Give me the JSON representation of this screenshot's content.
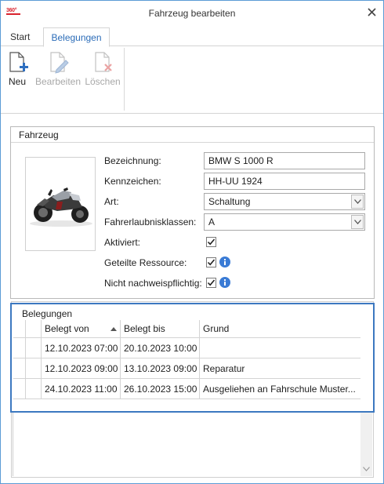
{
  "app": {
    "logo_text": "360°",
    "window_title": "Fahrzeug bearbeiten"
  },
  "tabs": [
    {
      "label": "Start",
      "active": false
    },
    {
      "label": "Belegungen",
      "active": true
    }
  ],
  "ribbon": {
    "new_label": "Neu",
    "edit_label": "Bearbeiten",
    "delete_label": "Löschen"
  },
  "vehicle": {
    "group_title": "Fahrzeug",
    "fields": {
      "bezeichnung": {
        "label": "Bezeichnung:",
        "value": "BMW S 1000 R"
      },
      "kennzeichen": {
        "label": "Kennzeichen:",
        "value": "HH-UU 1924"
      },
      "art": {
        "label": "Art:",
        "value": "Schaltung"
      },
      "fahrerlaubnisklassen": {
        "label": "Fahrerlaubnisklassen:",
        "value": "A"
      },
      "aktiviert": {
        "label": "Aktiviert:",
        "checked": true
      },
      "geteilte_ressource": {
        "label": "Geteilte Ressource:",
        "checked": true
      },
      "nicht_nachweispflichtig": {
        "label": "Nicht nachweispflichtig:",
        "checked": true
      }
    }
  },
  "bookings": {
    "group_title": "Belegungen",
    "columns": [
      "Belegt von",
      "Belegt bis",
      "Grund"
    ],
    "sort_column": "Belegt von",
    "sort_direction": "ascending",
    "rows": [
      {
        "von": "12.10.2023 07:00",
        "bis": "20.10.2023 10:00",
        "grund": ""
      },
      {
        "von": "12.10.2023 09:00",
        "bis": "13.10.2023 09:00",
        "grund": "Reparatur"
      },
      {
        "von": "24.10.2023 11:00",
        "bis": "26.10.2023 15:00",
        "grund": "Ausgeliehen an Fahrschule Muster..."
      }
    ]
  },
  "colors": {
    "accent": "#2b6cb8",
    "selection_border": "#3c78c0",
    "logo_red": "#d9232e",
    "info_blue": "#3a7bd5"
  }
}
